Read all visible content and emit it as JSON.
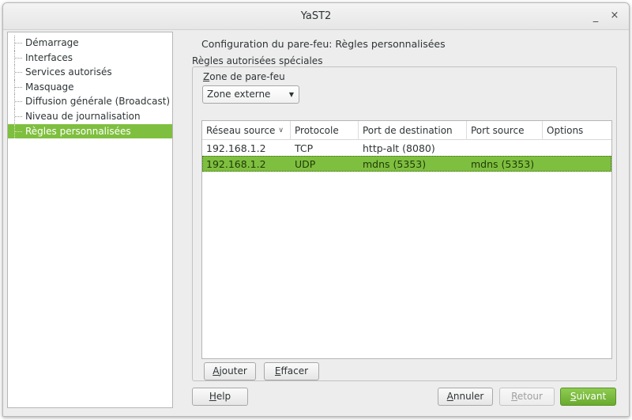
{
  "window": {
    "title": "YaST2",
    "minimize_label": "_",
    "close_label": "×"
  },
  "sidebar": {
    "items": [
      {
        "label": "Démarrage",
        "selected": false
      },
      {
        "label": "Interfaces",
        "selected": false
      },
      {
        "label": "Services autorisés",
        "selected": false
      },
      {
        "label": "Masquage",
        "selected": false
      },
      {
        "label": "Diffusion générale (Broadcast)",
        "selected": false
      },
      {
        "label": "Niveau de journalisation",
        "selected": false
      },
      {
        "label": "Règles personnalisées",
        "selected": true
      }
    ]
  },
  "main": {
    "heading": "Configuration du pare-feu: Règles personnalisées",
    "group_label": "Règles autorisées spéciales",
    "zone": {
      "label_first": "Z",
      "label_rest": "one de pare-feu",
      "selected": "Zone externe"
    },
    "table": {
      "columns": [
        "Réseau source",
        "Protocole",
        "Port de destination",
        "Port source",
        "Options"
      ],
      "sort_icon": "chevron-down-icon",
      "rows": [
        {
          "source": "192.168.1.2",
          "protocol": "TCP",
          "dest_port": "http-alt (8080)",
          "src_port": "",
          "options": "",
          "selected": false
        },
        {
          "source": "192.168.1.2",
          "protocol": "UDP",
          "dest_port": "mdns (5353)",
          "src_port": "mdns (5353)",
          "options": "",
          "selected": true
        }
      ]
    },
    "buttons": {
      "add": {
        "first": "A",
        "rest": "jouter"
      },
      "delete": {
        "first": "E",
        "rest": "ffacer"
      }
    }
  },
  "footer": {
    "help": {
      "first": "H",
      "rest": "elp"
    },
    "cancel": {
      "first": "A",
      "rest": "nnuler"
    },
    "back": {
      "first": "R",
      "rest": "etour"
    },
    "next": {
      "first": "S",
      "rest": "uivant"
    }
  },
  "colors": {
    "accent": "#7fbf3f",
    "window_bg": "#ededed"
  }
}
